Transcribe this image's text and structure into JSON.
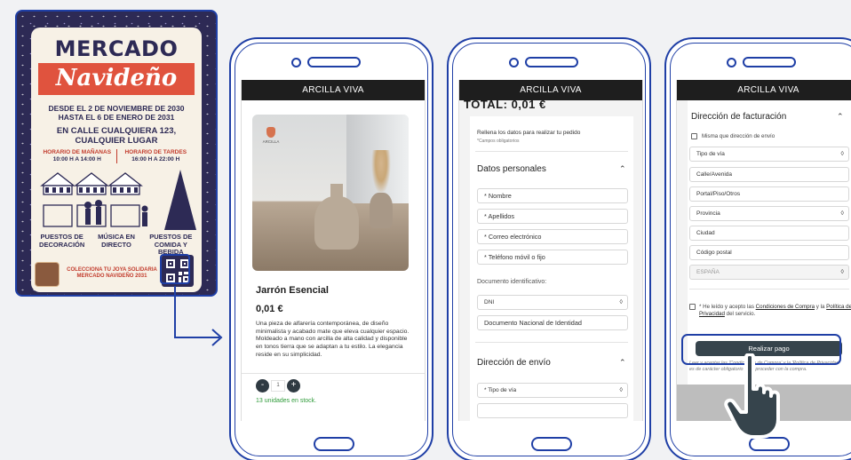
{
  "poster": {
    "title_line1": "MERCADO",
    "title_line2": "Navideño",
    "dates_line1": "DESDE EL 2 DE NOVIEMBRE DE 2030",
    "dates_line2": "HASTA EL 6 DE ENERO DE 2031",
    "address_line1": "EN CALLE CUALQUIERA 123,",
    "address_line2": "CUALQUIER LUGAR",
    "hours_morning_label": "HORARIO DE MAÑANAS",
    "hours_morning": "10:00 H A 14:00 H",
    "hours_evening_label": "HORARIO DE TARDES",
    "hours_evening": "16:00 H A 22:00 H",
    "cat1_line1": "PUESTOS DE",
    "cat1_line2": "DECORACIÓN",
    "cat2_line1": "MÚSICA EN",
    "cat2_line2": "DIRECTO",
    "cat3_line1": "PUESTOS DE",
    "cat3_line2": "COMIDA Y BEBIDA",
    "collect_line1": "COLECCIONA TU JOYA SOLIDARIA",
    "collect_line2": "MERCADO NAVIDEÑO 2031",
    "qr_icon": "qr-code-icon"
  },
  "app": {
    "brand": "ARCILLA VIVA"
  },
  "product": {
    "logo_text": "ARCILLA",
    "name": "Jarrón Esencial",
    "price": "0,01 €",
    "description": "Una pieza de alfarería contemporánea, de diseño minimalista y acabado mate que eleva cualquier espacio. Moldeado a mano con arcilla de alta calidad y disponible en tonos tierra que se adaptan a tu estilo. La elegancia reside en su simplicidad.",
    "qty_minus": "-",
    "qty_value": "1",
    "qty_plus": "+",
    "stock": "13 unidades en stock."
  },
  "checkout": {
    "total_label": "TOTAL: 0,01 €",
    "intro": "Rellena los datos para realizar tu pedido",
    "required_note": "*Campos obligatorios",
    "personal_section": "Datos personales",
    "name_ph": "* Nombre",
    "surname_ph": "* Apellidos",
    "email_ph": "* Correo electrónico",
    "phone_ph": "* Teléfono móvil o fijo",
    "id_doc_label": "Documento identificativo:",
    "id_type": "DNI",
    "id_number_ph": "Documento Nacional de Identidad",
    "shipping_section": "Dirección de envío",
    "shipping_road_type": "* Tipo de vía"
  },
  "billing": {
    "section": "Dirección de facturación",
    "same_as_shipping": "Misma que dirección de envío",
    "road_type": "Tipo de vía",
    "street": "Calle/Avenida",
    "door": "Portal/Piso/Otros",
    "province": "Provincia",
    "city": "Ciudad",
    "postal": "Código postal",
    "country": "ESPAÑA",
    "terms_prefix": "* He leído y acepto las",
    "terms_link": "Condiciones de Compra",
    "terms_mid": "y la",
    "privacy_link": "Política de Privacidad",
    "terms_suffix": "del servicio.",
    "pay_button": "Realizar pago",
    "note": "Leer y aceptar las 'Condiciones de Compra' y la 'Política de Privacidad' es de carácter obligatorio para proceder con la compra."
  },
  "colors": {
    "accent": "#1f3fa6",
    "app_bar": "#1e1e1e",
    "pay_button": "#36444c",
    "stock": "#2f9b3a"
  }
}
